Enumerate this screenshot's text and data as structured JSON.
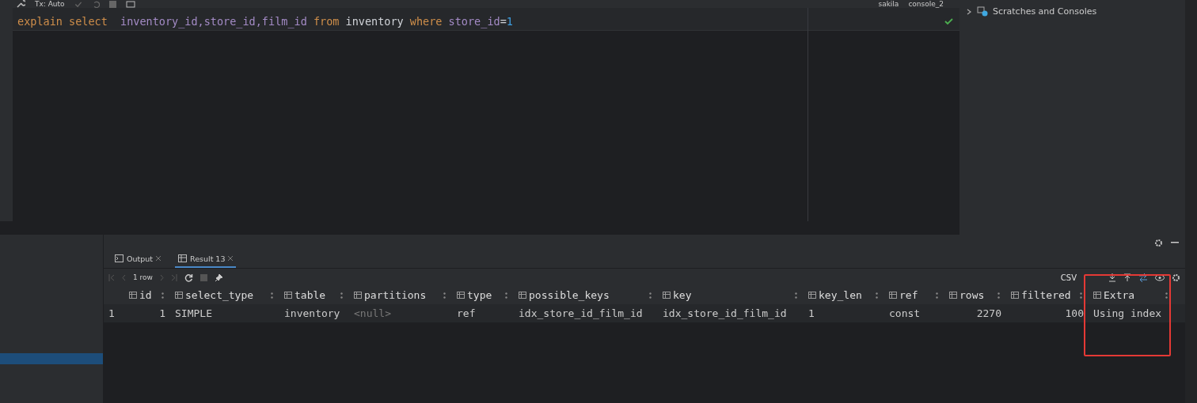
{
  "toolbar": {
    "tx_mode": "Tx: Auto",
    "schema": "sakila",
    "console": "console_2"
  },
  "editor": {
    "tokens": [
      {
        "text": "explain ",
        "kind": "keyword"
      },
      {
        "text": "select  ",
        "kind": "keyword"
      },
      {
        "text": "inventory_id,store_id,film_id ",
        "kind": "column"
      },
      {
        "text": "from",
        "kind": "keyword"
      },
      {
        "text": " inventory ",
        "kind": "plain"
      },
      {
        "text": "where ",
        "kind": "keyword"
      },
      {
        "text": "store_id",
        "kind": "column"
      },
      {
        "text": "=",
        "kind": "plain"
      },
      {
        "text": "1",
        "kind": "number"
      }
    ],
    "valid": true
  },
  "project_tree": {
    "items": [
      {
        "label": "Scratches and Consoles",
        "expanded": false
      }
    ]
  },
  "results": {
    "tabs": [
      {
        "label": "Output",
        "selected": false
      },
      {
        "label": "Result 13",
        "selected": true
      }
    ],
    "row_count": "1 row",
    "export_format": "CSV",
    "columns": [
      {
        "label": "id"
      },
      {
        "label": "select_type"
      },
      {
        "label": "table"
      },
      {
        "label": "partitions"
      },
      {
        "label": "type"
      },
      {
        "label": "possible_keys"
      },
      {
        "label": "key"
      },
      {
        "label": "key_len"
      },
      {
        "label": "ref"
      },
      {
        "label": "rows"
      },
      {
        "label": "filtered"
      },
      {
        "label": "Extra",
        "highlighted": true
      }
    ],
    "rows": [
      {
        "number": "1",
        "cells": [
          "1",
          "SIMPLE",
          "inventory",
          "<null>",
          "ref",
          "idx_store_id_film_id",
          "idx_store_id_film_id",
          "1",
          "const",
          "2270",
          "100",
          "Using index"
        ]
      }
    ]
  }
}
